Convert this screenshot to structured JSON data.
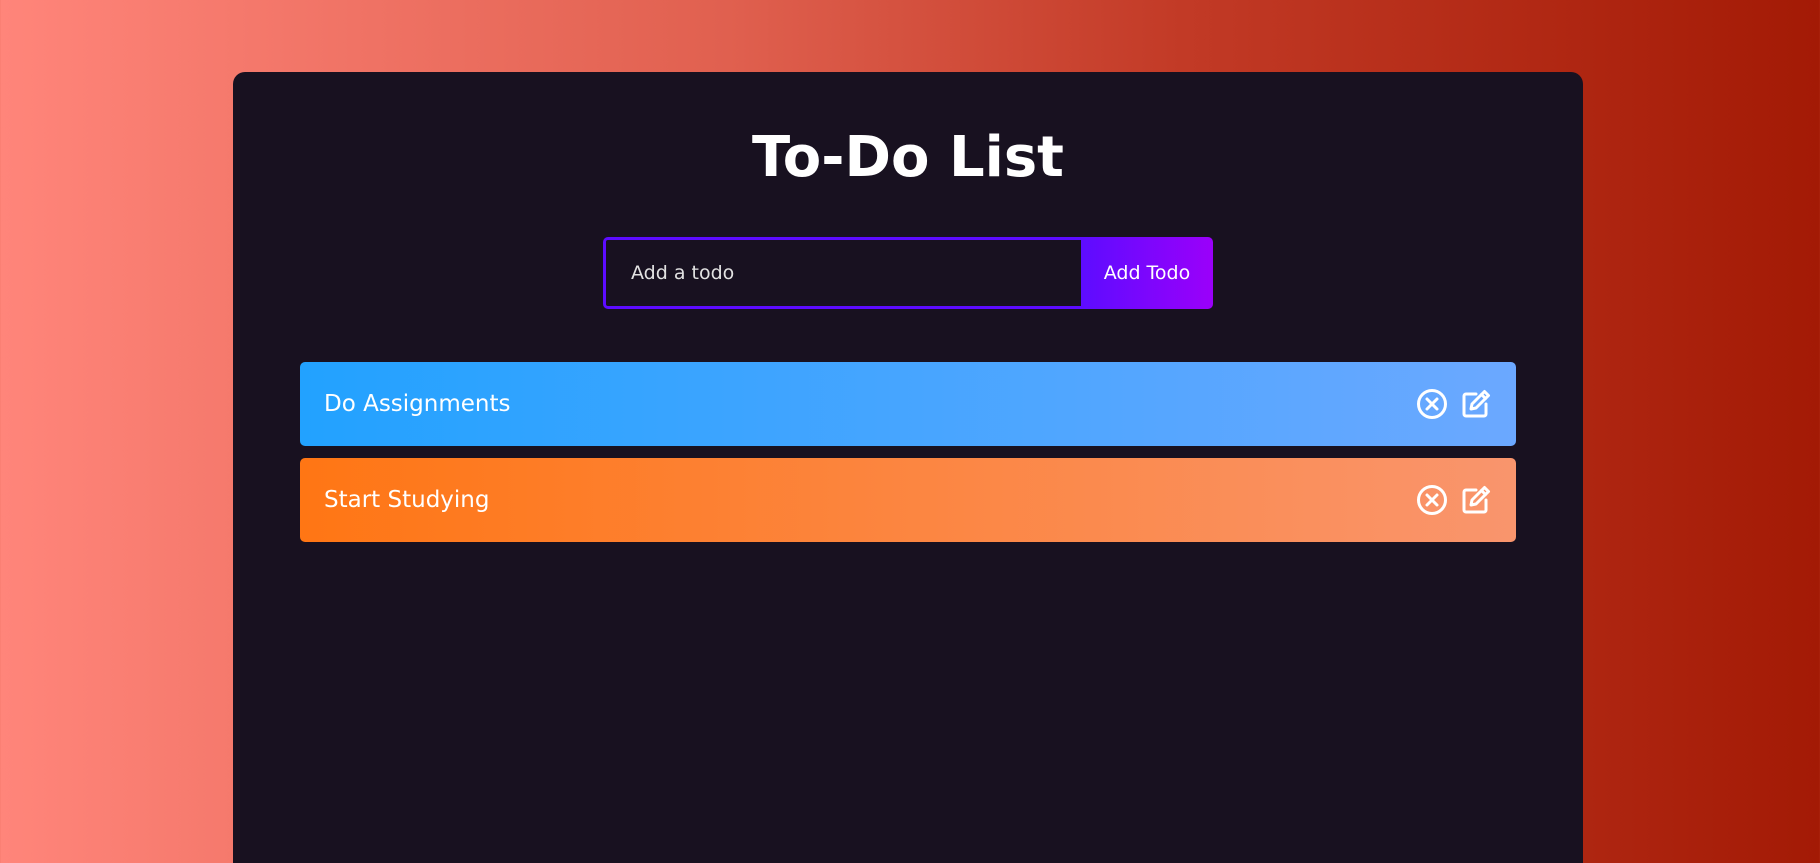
{
  "app": {
    "title": "To-Do List"
  },
  "form": {
    "input_placeholder": "Add a todo",
    "input_value": "",
    "button_label": "Add Todo"
  },
  "todos": [
    {
      "text": "Do Assignments",
      "color": "blue",
      "delete_icon": "circle-x-icon",
      "edit_icon": "edit-icon"
    },
    {
      "text": "Start Studying",
      "color": "orange",
      "delete_icon": "circle-x-icon",
      "edit_icon": "edit-icon"
    }
  ],
  "colors": {
    "background_gradient_start": "#ff857a",
    "background_gradient_end": "#a31a05",
    "app_background": "#181120",
    "accent_purple": "#5d0cff",
    "accent_purple_end": "#9b00fa",
    "todo_blue_start": "#22a2ff",
    "todo_blue_end": "#6ba8ff",
    "todo_orange_start": "#ff7614",
    "todo_orange_end": "#f9956d"
  }
}
